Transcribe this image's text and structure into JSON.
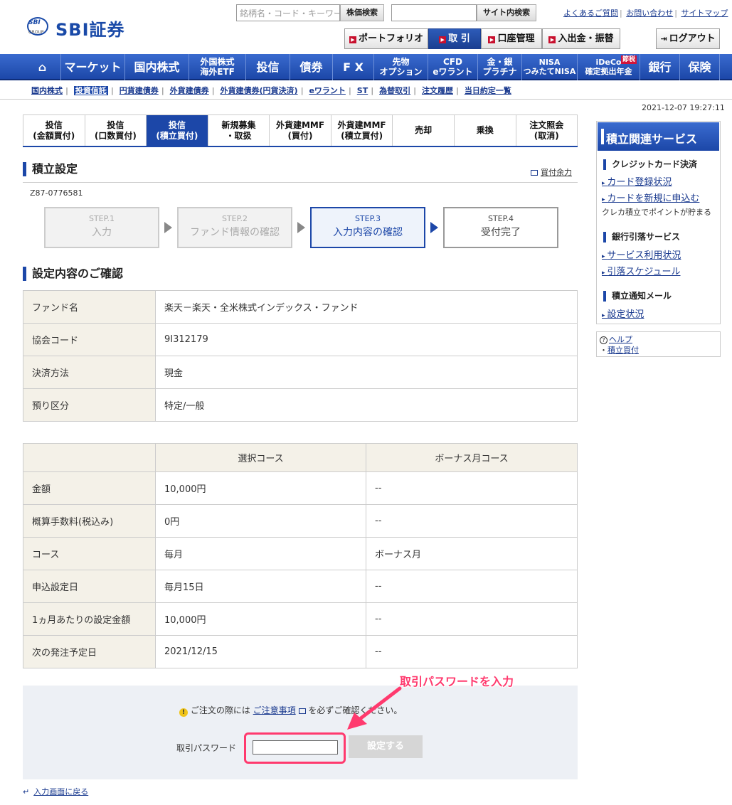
{
  "header": {
    "logo_mark": "SBI",
    "logo_group": "GROUP",
    "logo_text": "SBI証券",
    "search_placeholder": "銘柄名・コード・キーワード",
    "search_button": "株価検索",
    "site_search_button": "サイト内検索",
    "links": [
      "よくあるご質問",
      "お問い合わせ",
      "サイトマップ"
    ],
    "nav_buttons": [
      "ポートフォリオ",
      "取 引",
      "口座管理",
      "入出金・振替"
    ],
    "logout": "ログアウト"
  },
  "main_nav": {
    "home": "⌂",
    "items": [
      "マーケット",
      "国内株式",
      "外国株式\n海外ETF",
      "投信",
      "債券",
      "F X",
      "先物\nオプション",
      "CFD\neワラント",
      "金・銀\nプラチナ",
      "NISA\nつみたてNISA",
      "iDeCo\n確定拠出年金",
      "銀行",
      "保険"
    ],
    "ideco_badge": "節税"
  },
  "sub_nav": [
    "国内株式",
    "投資信託",
    "円貨建債券",
    "外貨建債券",
    "外貨建債券(円貨決済)",
    "eワラント",
    "ST",
    "為替取引",
    "注文履歴",
    "当日約定一覧"
  ],
  "datetime": "2021-12-07 19:27:11",
  "tabs": [
    "投信\n(金額買付)",
    "投信\n(口数買付)",
    "投信\n(積立買付)",
    "新規募集\n・取扱",
    "外貨建MMF\n(買付)",
    "外貨建MMF\n(積立買付)",
    "売却",
    "乗換",
    "注文照会\n(取消)"
  ],
  "page": {
    "title": "積立設定",
    "buying_power": "買付余力",
    "account": "Z87-0776581",
    "steps": [
      {
        "num": "STEP.1",
        "label": "入力"
      },
      {
        "num": "STEP.2",
        "label": "ファンド情報の確認"
      },
      {
        "num": "STEP.3",
        "label": "入力内容の確認"
      },
      {
        "num": "STEP.4",
        "label": "受付完了"
      }
    ],
    "confirm_title": "設定内容のご確認"
  },
  "fund_table": [
    {
      "label": "ファンド名",
      "value": "楽天－楽天・全米株式インデックス・ファンド"
    },
    {
      "label": "協会コード",
      "value": "9I312179"
    },
    {
      "label": "決済方法",
      "value": "現金"
    },
    {
      "label": "預り区分",
      "value": "特定/一般"
    }
  ],
  "course_table": {
    "headers": [
      "",
      "選択コース",
      "ボーナス月コース"
    ],
    "rows": [
      {
        "label": "金額",
        "selected": "10,000円",
        "bonus": "--"
      },
      {
        "label": "概算手数料(税込み)",
        "selected": "0円",
        "bonus": "--"
      },
      {
        "label": "コース",
        "selected": "毎月",
        "bonus": "ボーナス月"
      },
      {
        "label": "申込設定日",
        "selected": "毎月15日",
        "bonus": "--"
      },
      {
        "label": "1ヵ月あたりの設定金額",
        "selected": "10,000円",
        "bonus": "--"
      },
      {
        "label": "次の発注予定日",
        "selected": "2021/12/15",
        "bonus": "--"
      }
    ]
  },
  "confirm": {
    "notice_pre": "ご注文の際には",
    "notice_link": "ご注意事項",
    "notice_post": "を必ずご確認ください。",
    "password_label": "取引パスワード",
    "password_value": "",
    "submit": "設定する",
    "annotation": "取引パスワードを入力"
  },
  "back_link": "入力画面に戻る",
  "sidebar": {
    "title": "積立関連サービス",
    "groups": [
      {
        "heading": "クレジットカード決済",
        "links": [
          "カード登録状況",
          "カードを新規に申込む"
        ],
        "note": "クレカ積立でポイントが貯まる"
      },
      {
        "heading": "銀行引落サービス",
        "links": [
          "サービス利用状況",
          "引落スケジュール"
        ],
        "note": ""
      },
      {
        "heading": "積立通知メール",
        "links": [
          "設定状況"
        ],
        "note": ""
      }
    ],
    "help": "ヘルプ",
    "help_item": "積立買付"
  },
  "colors": {
    "brand": "#1c47a8",
    "accent": "#ff3a6e",
    "red": "#c8102e"
  }
}
